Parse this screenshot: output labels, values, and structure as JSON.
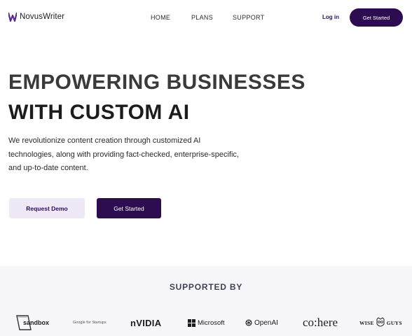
{
  "header": {
    "brand": "NovusWriter",
    "nav": [
      "HOME",
      "PLANS",
      "SUPPORT"
    ],
    "login": "Log in",
    "cta": "Get Started"
  },
  "hero": {
    "title_line1": "EMPOWERING BUSINESSES",
    "title_line2": "WITH CUSTOM AI",
    "description": "We revolutionize content creation through customized AI technologies, along with providing fact-checked, enterprise-specific, and up-to-date content.",
    "demo_button": "Request Demo",
    "start_button": "Get Started"
  },
  "supported": {
    "title": "SUPPORTED BY",
    "logos": {
      "sandbox": "sandbox",
      "google": "Google for Startups",
      "nvidia": "nVIDIA",
      "microsoft": "Microsoft",
      "openai": "OpenAI",
      "cohere": "co:here",
      "wise_left": "WISE",
      "wise_right": "GUYS"
    }
  },
  "colors": {
    "brand_dark": "#2d0c4f",
    "demo_bg": "#efe8f7",
    "section_bg": "#f7f6fa",
    "logo_purple": "#5b2a86"
  }
}
